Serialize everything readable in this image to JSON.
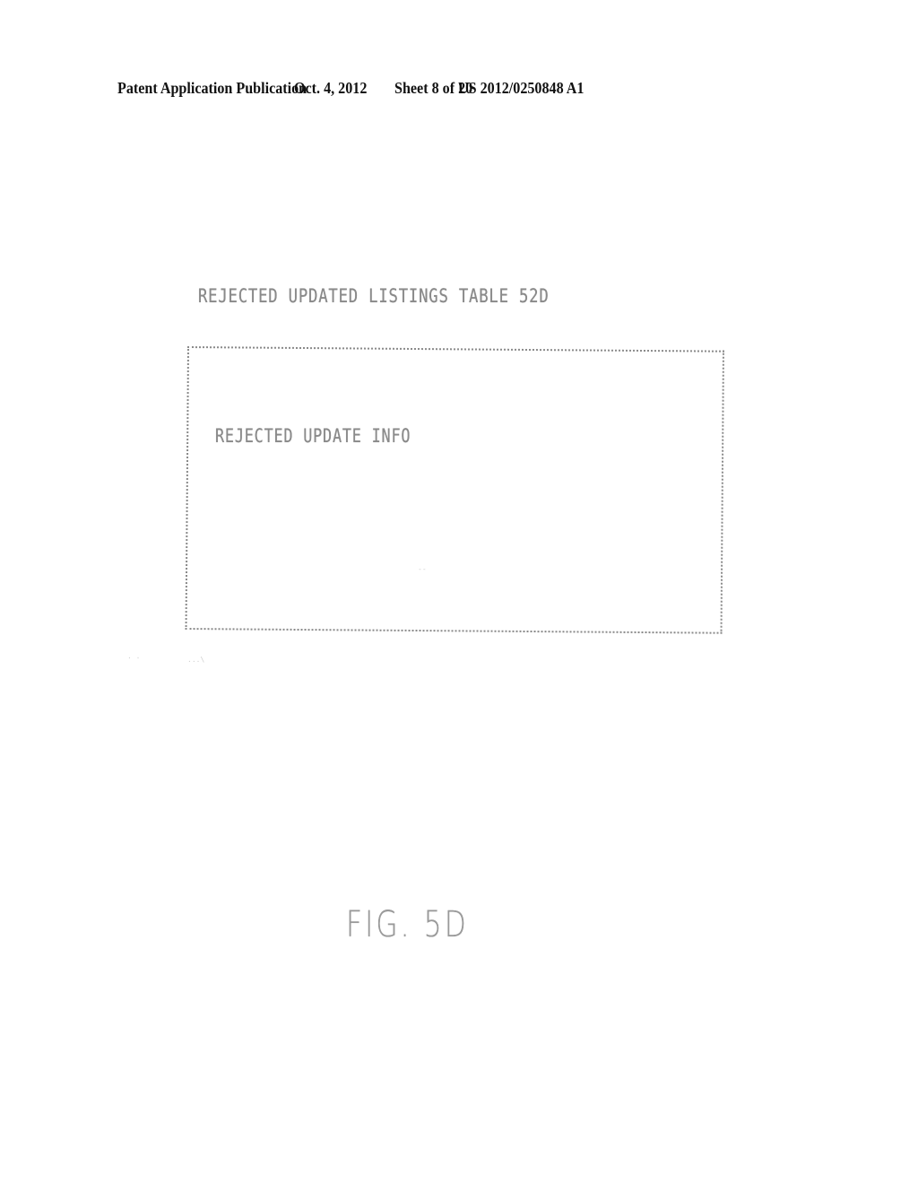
{
  "header": {
    "publication_type": "Patent Application Publication",
    "date": "Oct. 4, 2012",
    "sheet": "Sheet 8 of 20",
    "publication_number": "US 2012/0250848 A1"
  },
  "figure": {
    "table_title": "REJECTED UPDATED LISTINGS TABLE 52D",
    "table_fields": [
      "REJECTED UPDATE INFO"
    ],
    "caption": "FIG. 5D"
  }
}
